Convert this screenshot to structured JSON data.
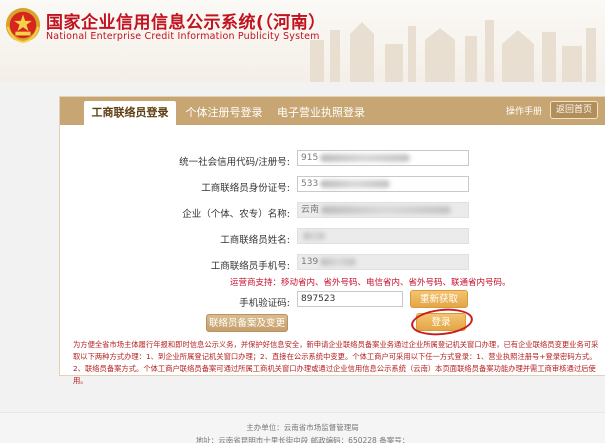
{
  "header": {
    "title_cn": "国家企业信用信息公示系统(（河南）",
    "title_en": "National Enterprise Credit Information Publicity System"
  },
  "tabs": [
    {
      "label": "工商联络员登录",
      "active": true
    },
    {
      "label": "个体注册号登录",
      "active": false
    },
    {
      "label": "电子营业执照登录",
      "active": false
    }
  ],
  "toolbar": {
    "manual_label": "操作手册",
    "home_label": "返回首页"
  },
  "form": {
    "credit_code": {
      "label": "统一社会信用代码/注册号:",
      "value_prefix": "915"
    },
    "id_number": {
      "label": "工商联络员身份证号:",
      "value_prefix": "533"
    },
    "company_name": {
      "label": "企业（个体、农专）名称:",
      "value_prefix": "云南"
    },
    "contact_name": {
      "label": "工商联络员姓名:",
      "value_prefix": ""
    },
    "contact_phone": {
      "label": "工商联络员手机号:",
      "value_prefix": "139"
    },
    "carrier_note": "运营商支持：移动省内、省外号码、电信省内、省外号码、联通省内号码。",
    "sms_code": {
      "label": "手机验证码:",
      "value": "897523"
    },
    "resend_label": "重新获取",
    "register_label": "联络员备案及变更",
    "login_label": "登录"
  },
  "notice": "为方便全省市场主体履行年报和即时信息公示义务，并保护好信息安全，新申请企业联络员备案业务通过企业所属登记机关窗口办理，已有企业联络员变更业务可采取以下两种方式办理：1、到企业所属登记机关窗口办理；2、直接在公示系统中变更。个体工商户可采用以下任一方式登录：1、营业执照注册号+登录密码方式。2、联络员备案方式。个体工商户联络员备案可通过所属工商机关窗口办理或通过企业信用信息公示系统（云南）本页面联络员备案功能办理并需工商审核通过后使用。",
  "footer": {
    "sponsor": "主办单位：云南省市场监督管理局",
    "address": "地址：云南省昆明市十里长街中段 邮政编码：650228 备案号："
  },
  "colors": {
    "brand_red": "#c1121f",
    "tab_bar": "#c8a673",
    "button_gold": "#e3a646",
    "notice_red": "#b41e1e"
  }
}
